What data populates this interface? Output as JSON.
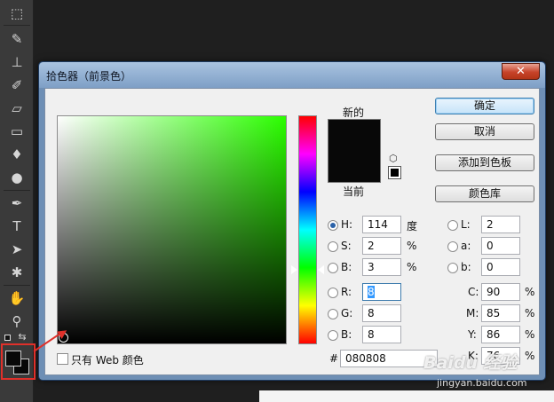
{
  "dialog": {
    "title": "拾色器（前景色）",
    "close_glyph": "✕",
    "new_label": "新的",
    "current_label": "当前",
    "new_color": "#080808",
    "current_color": "#080808",
    "web_only_label": "只有 Web 颜色",
    "buttons": {
      "ok": "确定",
      "cancel": "取消",
      "add_to_swatches": "添加到色板",
      "color_libraries": "颜色库"
    },
    "hsb": {
      "h_label": "H:",
      "h_value": "114",
      "h_unit": "度",
      "s_label": "S:",
      "s_value": "2",
      "s_unit": "%",
      "b_label": "B:",
      "b_value": "3",
      "b_unit": "%"
    },
    "rgb": {
      "r_label": "R:",
      "r_value": "8",
      "g_label": "G:",
      "g_value": "8",
      "b_label": "B:",
      "b_value": "8"
    },
    "lab": {
      "l_label": "L:",
      "l_value": "2",
      "a_label": "a:",
      "a_value": "0",
      "b_label": "b:",
      "b_value": "0"
    },
    "cmyk": {
      "c_label": "C:",
      "c_value": "90",
      "c_unit": "%",
      "m_label": "M:",
      "m_value": "85",
      "m_unit": "%",
      "y_label": "Y:",
      "y_value": "86",
      "y_unit": "%",
      "k_label": "K:",
      "k_value": "76",
      "k_unit": "%"
    },
    "hex": {
      "hash": "#",
      "value": "080808"
    },
    "field_hue_color": "#2bff00"
  },
  "toolbar": {
    "tools": [
      "marquee-icon",
      "brush-icon",
      "stamp-icon",
      "history-brush-icon",
      "eraser-icon",
      "gradient-icon",
      "blur-icon",
      "dodge-icon",
      "pen-icon",
      "type-icon",
      "path-select-icon",
      "shape-icon",
      "hand-icon",
      "zoom-icon"
    ],
    "foreground_color": "#080808",
    "background_color": "#080808",
    "highlight_color": "#e0302a"
  },
  "watermark": {
    "main": "Baidu 经验",
    "sub": "jingyan.baidu.com"
  }
}
